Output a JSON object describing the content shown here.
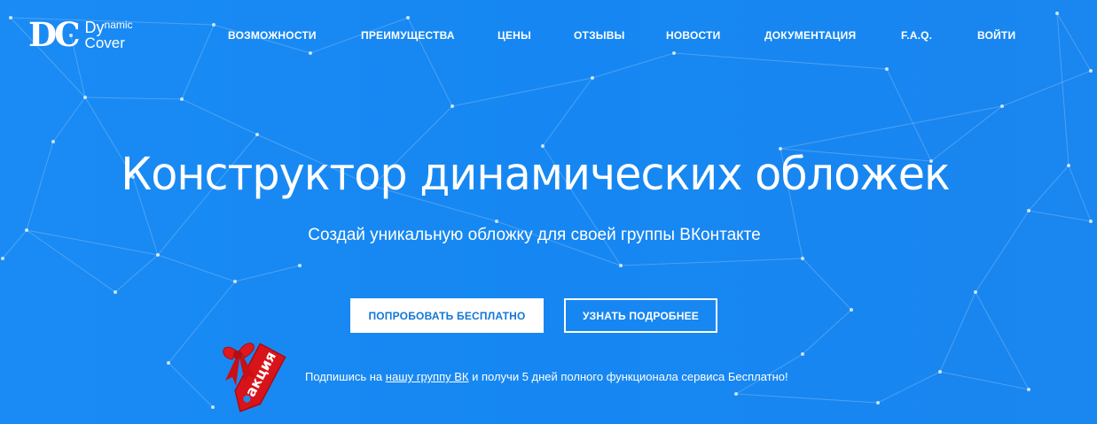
{
  "logo": {
    "mark": "DC",
    "line1_a": "Dy",
    "line1_b": "namic",
    "line2": "Cover"
  },
  "nav": {
    "items": [
      {
        "label": "ВОЗМОЖНОСТИ"
      },
      {
        "label": "ПРЕИМУЩЕСТВА"
      },
      {
        "label": "ЦЕНЫ"
      },
      {
        "label": "ОТЗЫВЫ"
      },
      {
        "label": "НОВОСТИ"
      },
      {
        "label": "ДОКУМЕНТАЦИЯ"
      },
      {
        "label": "F.A.Q."
      },
      {
        "label": "ВОЙТИ"
      }
    ]
  },
  "hero": {
    "title": "Конструктор динамических обложек",
    "subtitle": "Создай уникальную обложку для своей группы ВКонтакте",
    "primary_button": "ПОПРОБОВАТЬ БЕСПЛАТНО",
    "secondary_button": "УЗНАТЬ ПОДРОБНЕЕ"
  },
  "promo": {
    "badge_label": "акция",
    "text_before": "Подпишись на ",
    "link_text": "нашу группу ВК",
    "text_after": " и получи 5 дней полного функционала сервиса Бесплатно!"
  },
  "colors": {
    "background": "#1a8bf4",
    "primary_button_text": "#1577d6",
    "ribbon_red": "#d8141a"
  }
}
